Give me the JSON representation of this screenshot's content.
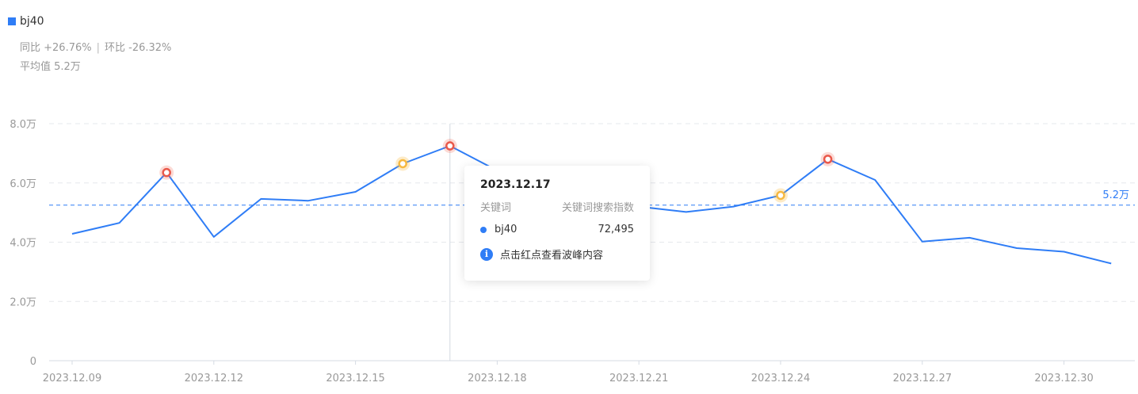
{
  "legend": {
    "series_name": "bj40",
    "color": "#2f7df6"
  },
  "stats": {
    "yoy": "同比 +26.76%",
    "mom": "环比 -26.32%",
    "average": "平均值 5.2万"
  },
  "tooltip": {
    "date": "2023.12.17",
    "col_keyword": "关键词",
    "col_index": "关键词搜索指数",
    "keyword": "bj40",
    "value": "72,495",
    "hint": "点击红点查看波峰内容",
    "info_glyph": "i"
  },
  "chart_data": {
    "type": "line",
    "x": [
      "2023.12.09",
      "2023.12.10",
      "2023.12.11",
      "2023.12.12",
      "2023.12.13",
      "2023.12.14",
      "2023.12.15",
      "2023.12.16",
      "2023.12.17",
      "2023.12.18",
      "2023.12.19",
      "2023.12.20",
      "2023.12.21",
      "2023.12.22",
      "2023.12.23",
      "2023.12.24",
      "2023.12.25",
      "2023.12.26",
      "2023.12.27",
      "2023.12.28",
      "2023.12.29",
      "2023.12.30",
      "2023.12.31"
    ],
    "x_tick_labels": [
      "2023.12.09",
      "2023.12.12",
      "2023.12.15",
      "2023.12.18",
      "2023.12.21",
      "2023.12.24",
      "2023.12.27",
      "2023.12.30"
    ],
    "series": [
      {
        "name": "bj40",
        "color": "#2f7df6",
        "values": [
          42800,
          46500,
          63500,
          41800,
          54600,
          54000,
          57000,
          66500,
          72495,
          64200,
          64300,
          53500,
          52000,
          50200,
          52000,
          55800,
          68000,
          61000,
          40200,
          41500,
          38000,
          36800,
          32800
        ]
      }
    ],
    "peak_markers": [
      {
        "date": "2023.12.11",
        "level": "red"
      },
      {
        "date": "2023.12.16",
        "level": "yellow"
      },
      {
        "date": "2023.12.17",
        "level": "red"
      },
      {
        "date": "2023.12.24",
        "level": "yellow"
      },
      {
        "date": "2023.12.25",
        "level": "red"
      }
    ],
    "average_line": {
      "value": 52500,
      "label": "5.2万"
    },
    "y_ticks": [
      {
        "value": 0,
        "label": "0"
      },
      {
        "value": 20000,
        "label": "2.0万"
      },
      {
        "value": 40000,
        "label": "4.0万"
      },
      {
        "value": 60000,
        "label": "6.0万"
      },
      {
        "value": 80000,
        "label": "8.0万"
      }
    ],
    "ylim": [
      0,
      80000
    ],
    "highlighted_date": "2023.12.17",
    "grid": true
  }
}
